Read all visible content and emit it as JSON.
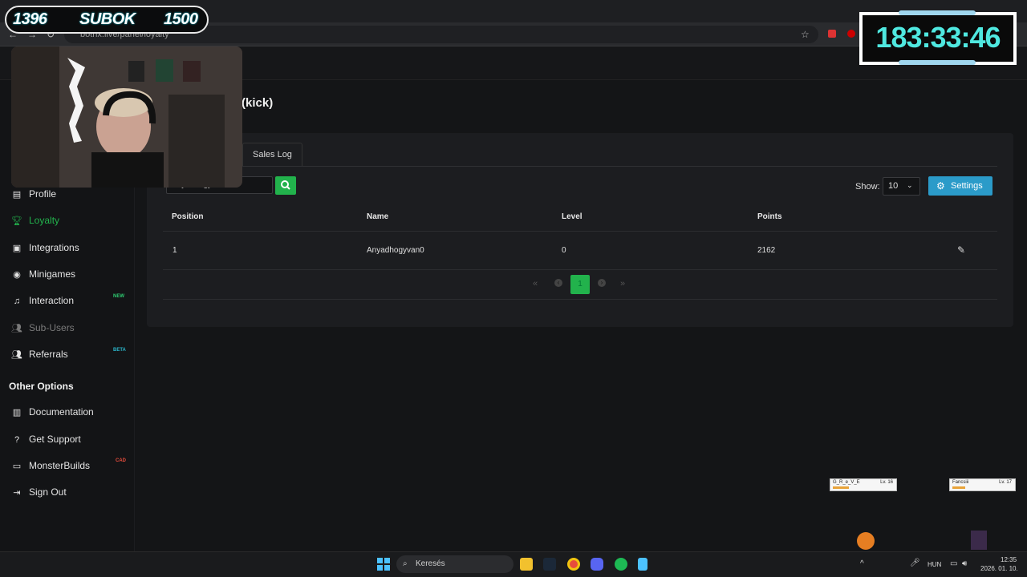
{
  "browser": {
    "url": "botrix.live/panel/loyalty"
  },
  "page": {
    "title": "(kick)",
    "tabs": [
      "Sales Log"
    ]
  },
  "toolbar": {
    "search_value": "Anyadhogyvan0",
    "show_label": "Show:",
    "show_value": "10",
    "settings_label": "Settings"
  },
  "table": {
    "headers": [
      "Position",
      "Name",
      "Level",
      "Points"
    ],
    "rows": [
      {
        "position": "1",
        "name": "Anyadhogyvan0",
        "level": "0",
        "points": "2162"
      }
    ]
  },
  "pagination": {
    "current": "1",
    "first": "«",
    "prev": "‹",
    "next": "›",
    "last": "»"
  },
  "sidebar": {
    "items": [
      {
        "label": "Profile",
        "icon": "id-card-icon"
      },
      {
        "label": "Loyalty",
        "icon": "trophy-icon",
        "active": true
      },
      {
        "label": "Integrations",
        "icon": "plug-icon"
      },
      {
        "label": "Minigames",
        "icon": "gamepad-icon"
      },
      {
        "label": "Interaction",
        "icon": "music-icon",
        "badge": "NEW"
      },
      {
        "label": "Sub-Users",
        "icon": "users-icon",
        "disabled": true
      },
      {
        "label": "Referrals",
        "icon": "user-group-icon",
        "badge": "BETA"
      }
    ],
    "section_title": "Other Options",
    "other": [
      {
        "label": "Documentation",
        "icon": "book-icon"
      },
      {
        "label": "Get Support",
        "icon": "question-icon"
      },
      {
        "label": "MonsterBuilds",
        "icon": "monitor-icon",
        "badge": "CAD"
      },
      {
        "label": "Sign Out",
        "icon": "sign-out-icon"
      }
    ]
  },
  "overlay": {
    "left_score": "1396",
    "sub_label": "SUBOK",
    "right_score": "1500",
    "timer": "183:33:46"
  },
  "taskbar": {
    "search_placeholder": "Keresés",
    "lang": "HUN",
    "time": "12:35",
    "date": "2026. 01. 10."
  },
  "mini_cards": [
    {
      "name": "G_R_e_V_E",
      "level": "Lv. 16"
    },
    {
      "name": "Fancsiii",
      "level": "Lv. 17"
    }
  ],
  "colors": {
    "accent_green": "#22b24c",
    "settings_blue": "#2b9bc9",
    "timer_cyan": "#4fe8e0",
    "badge_new": "#2ecc71",
    "badge_beta": "#2bb5c9",
    "badge_cad": "#e74c3c"
  }
}
